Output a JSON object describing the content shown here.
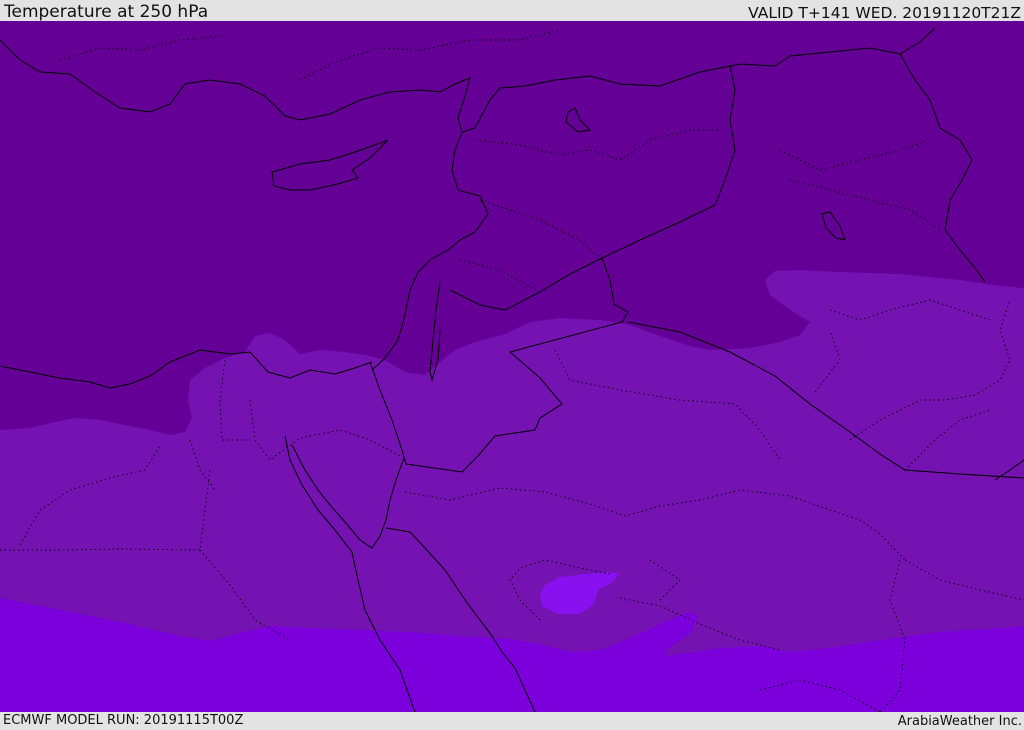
{
  "header": {
    "title": "Temperature at 250 hPa",
    "valid_time": "VALID T+141 WED. 20191120T21Z"
  },
  "footer": {
    "model_run": "ECMWF MODEL RUN: 20191115T00Z",
    "credit": "ArabiaWeather Inc."
  },
  "colors": {
    "band_coldest": "#640095",
    "band_middle": "#7412b2",
    "band_warmer": "#7c00dc",
    "band_warmest_patch": "#8a11ef",
    "coastline": "#000000",
    "bar_background": "#e3e3e3"
  }
}
